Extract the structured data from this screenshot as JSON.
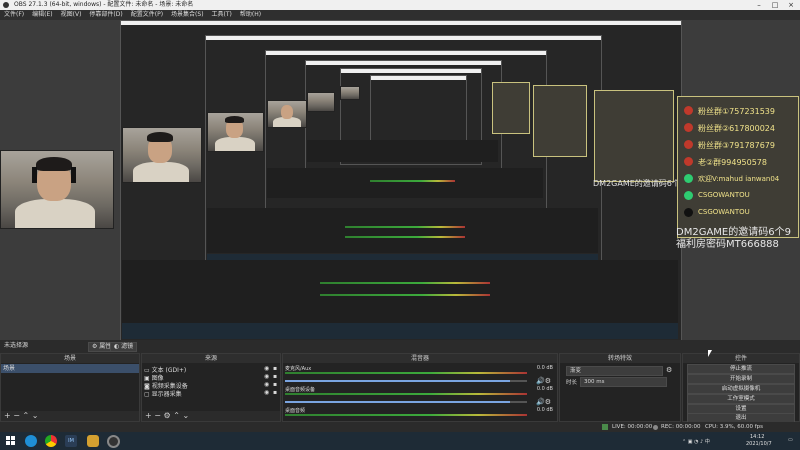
{
  "window": {
    "title": "OBS 27.1.3 (64-bit, windows) - 配置文件: 未命名 - 场景: 未命名"
  },
  "menu": [
    "文件(F)",
    "编辑(E)",
    "视图(V)",
    "停靠部件(D)",
    "配置文件(P)",
    "场景集合(S)",
    "工具(T)",
    "帮助(H)"
  ],
  "overlay": {
    "lines": [
      {
        "icon": "avatar-icon",
        "color": "#c0392b",
        "text": "粉丝群①757231539"
      },
      {
        "icon": "avatar-icon",
        "color": "#c0392b",
        "text": "粉丝群②617800024"
      },
      {
        "icon": "avatar-icon",
        "color": "#c0392b",
        "text": "粉丝群③791787679"
      },
      {
        "icon": "avatar-icon",
        "color": "#c0392b",
        "text": "老②群994950578"
      },
      {
        "icon": "wechat-icon",
        "color": "#2ecc71",
        "text": "欢迎V:mahud ianwan04"
      },
      {
        "icon": "wechat-icon",
        "color": "#2ecc71",
        "text": "CSGOWANTOU"
      },
      {
        "icon": "tiktok-icon",
        "color": "#111111",
        "text": "CSGOWANTOU"
      }
    ],
    "promo_line1": "DM2GAME的邀请码6个9",
    "promo_line2": "福利房密码MT666888"
  },
  "scene_label": "未选择源",
  "scene_bar_buttons": [
    "属性",
    "滤镜"
  ],
  "docks": {
    "scenes": {
      "title": "场景",
      "items": [
        "场景"
      ]
    },
    "sources": {
      "title": "来源",
      "items": [
        {
          "icon": "text-icon",
          "label": "文本 (GDI+)"
        },
        {
          "icon": "image-icon",
          "label": "图像"
        },
        {
          "icon": "camera-icon",
          "label": "视频采集设备"
        },
        {
          "icon": "monitor-icon",
          "label": "显示器采集"
        }
      ]
    },
    "mixer": {
      "title": "混音器",
      "channels": [
        {
          "name": "麦克风/Aux",
          "db": "0.0 dB",
          "volume": 0.93
        },
        {
          "name": "桌面音频设备",
          "db": "0.0 dB",
          "volume": 0.93
        },
        {
          "name": "桌面音频",
          "db": "0.0 dB",
          "volume": 0.93
        }
      ]
    },
    "transitions": {
      "title": "转场特效",
      "selected": "渐变",
      "duration_label": "时长",
      "duration_value": "300 ms"
    },
    "controls": {
      "title": "控件",
      "buttons": [
        "停止推流",
        "开始录制",
        "启动虚拟摄像机",
        "工作室模式",
        "设置",
        "退出"
      ]
    }
  },
  "status": {
    "live": "LIVE: 00:00:00",
    "rec": "REC: 00:00:00",
    "cpu": "CPU: 3.9%, 60.00 fps"
  },
  "taskbar": {
    "time": "14:12",
    "date": "2021/10/7"
  }
}
